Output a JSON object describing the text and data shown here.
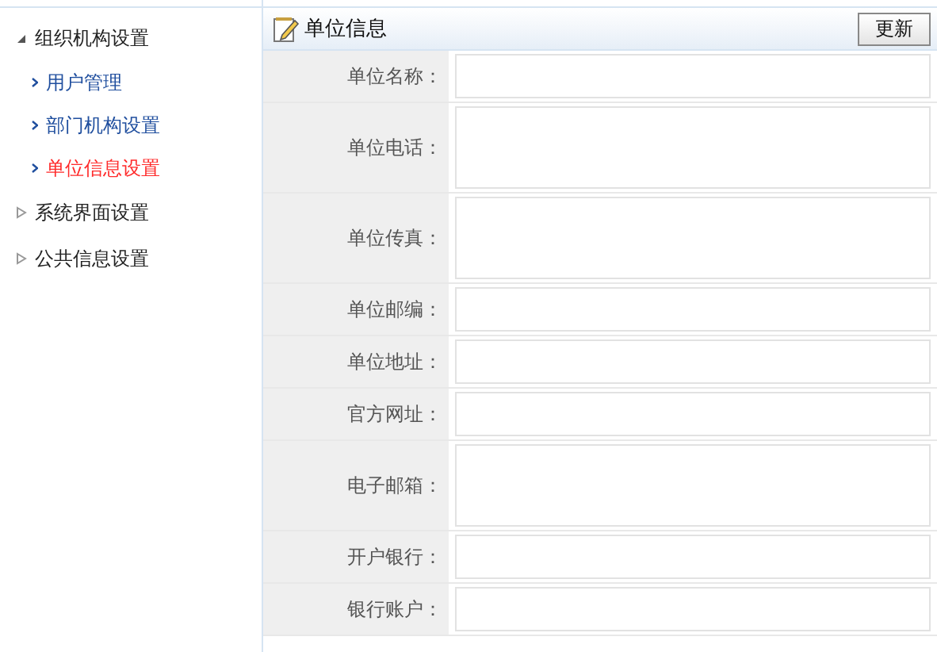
{
  "sidebar": {
    "groups": [
      {
        "label": "组织机构设置",
        "expanded": true,
        "children": [
          {
            "label": "用户管理",
            "selected": false
          },
          {
            "label": "部门机构设置",
            "selected": false
          },
          {
            "label": "单位信息设置",
            "selected": true
          }
        ]
      },
      {
        "label": "系统界面设置",
        "expanded": false
      },
      {
        "label": "公共信息设置",
        "expanded": false
      }
    ]
  },
  "panel": {
    "title": "单位信息",
    "button": "更新",
    "fields": [
      {
        "label": "单位名称：",
        "kind": "input"
      },
      {
        "label": "单位电话：",
        "kind": "textarea"
      },
      {
        "label": "单位传真：",
        "kind": "textarea"
      },
      {
        "label": "单位邮编：",
        "kind": "input"
      },
      {
        "label": "单位地址：",
        "kind": "input"
      },
      {
        "label": "官方网址：",
        "kind": "input"
      },
      {
        "label": "电子邮箱：",
        "kind": "textarea"
      },
      {
        "label": "开户银行：",
        "kind": "input"
      },
      {
        "label": "银行账户：",
        "kind": "input"
      }
    ]
  }
}
